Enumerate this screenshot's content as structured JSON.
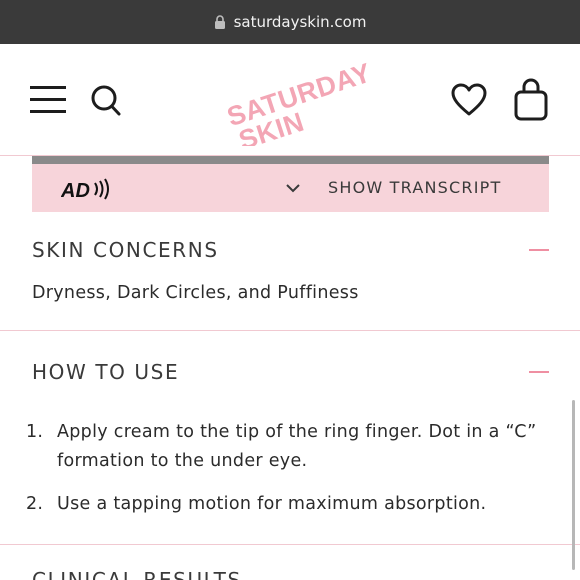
{
  "browser": {
    "url": "saturdayskin.com"
  },
  "header": {
    "logo_line1": "SATURDAY",
    "logo_line2": "SKIN"
  },
  "transcript_bar": {
    "label": "SHOW TRANSCRIPT",
    "ad_icon": "audio-description-icon"
  },
  "skin_concerns": {
    "title": "SKIN CONCERNS",
    "text": "Dryness, Dark Circles, and Puffiness"
  },
  "how_to_use": {
    "title": "HOW TO USE",
    "steps": [
      {
        "num": "1.",
        "text": "Apply cream to the tip of the ring finger. Dot in a “C” formation to the under eye."
      },
      {
        "num": "2.",
        "text": "Use a tapping motion for maximum absorption."
      }
    ]
  },
  "next_section": {
    "title": "CLINICAL RESULTS"
  },
  "colors": {
    "accent_pink": "#ef8fa2",
    "band_pink": "#f7d4da",
    "logo_pink": "#f3a6b5"
  }
}
